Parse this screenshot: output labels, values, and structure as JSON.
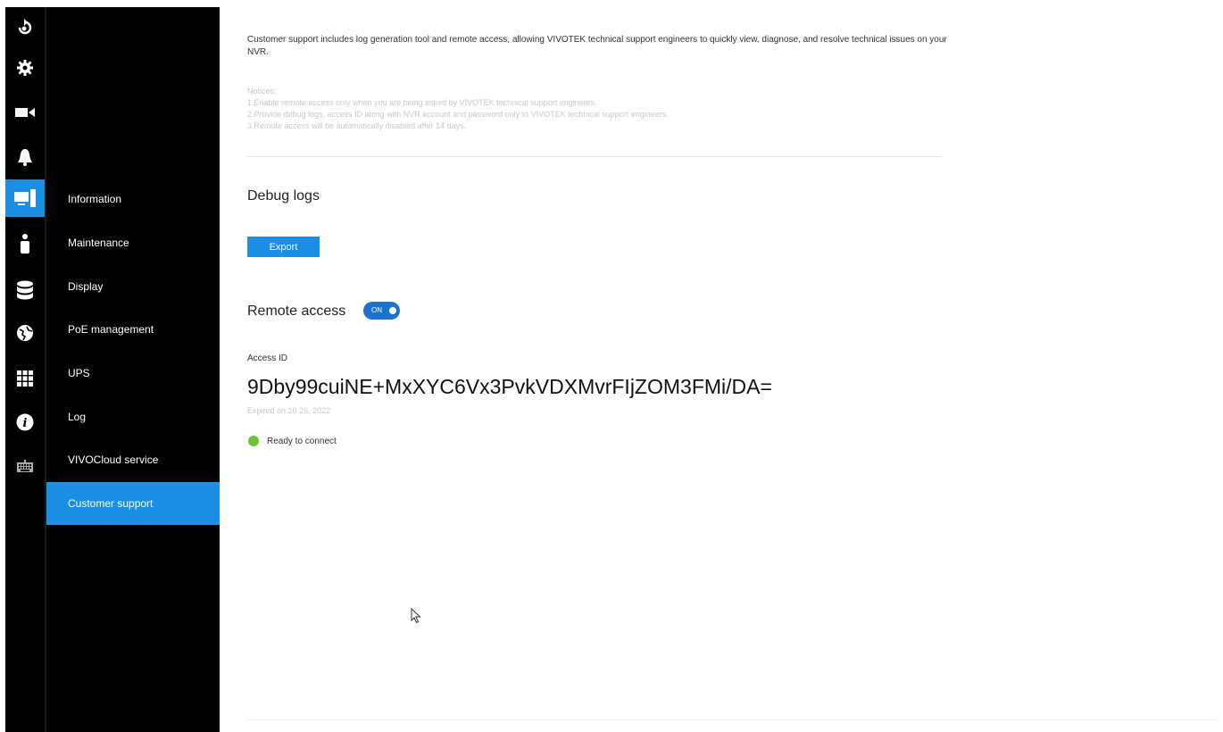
{
  "rail": {
    "icons": [
      "playback-icon",
      "settings-gear-icon",
      "camera-icon",
      "alarm-bell-icon",
      "system-monitor-icon",
      "user-icon",
      "storage-database-icon",
      "network-globe-icon",
      "grid-apps-icon",
      "info-icon",
      "keyboard-icon"
    ],
    "active_index": 4
  },
  "menu": {
    "items": [
      {
        "label": "Information"
      },
      {
        "label": "Maintenance"
      },
      {
        "label": "Display"
      },
      {
        "label": "PoE management"
      },
      {
        "label": "UPS"
      },
      {
        "label": "Log"
      },
      {
        "label": "VIVOCloud service"
      },
      {
        "label": "Customer support"
      }
    ],
    "active_index": 7
  },
  "main": {
    "intro": "Customer support includes log generation tool and remote access, allowing VIVOTEK technical support engineers to quickly view, diagnose, and resolve technical issues on your NVR.",
    "notices": {
      "heading": "Notices:",
      "lines": [
        "1.Enable remote access only when you are being asked by VIVOTEK technical support engineers.",
        "2.Provide debug logs, access ID along with NVR account and password only to VIVOTEK technical support engineers.",
        "3.Remote access will be automatically disabled after 14 days."
      ]
    },
    "debug_logs": {
      "title": "Debug logs",
      "export_label": "Export"
    },
    "remote_access": {
      "title": "Remote access",
      "toggle_label": "ON",
      "access_id_label": "Access ID",
      "access_id": "9Dby99cuiNE+MxXYC6Vx3PvkVDXMvrFIjZOM3FMi/DA=",
      "expired": "Expired on 10 26, 2022",
      "status": "Ready to connect",
      "status_color": "#6cc530"
    }
  },
  "colors": {
    "accent": "#1a8fe3",
    "sidebar_bg": "#000000"
  }
}
